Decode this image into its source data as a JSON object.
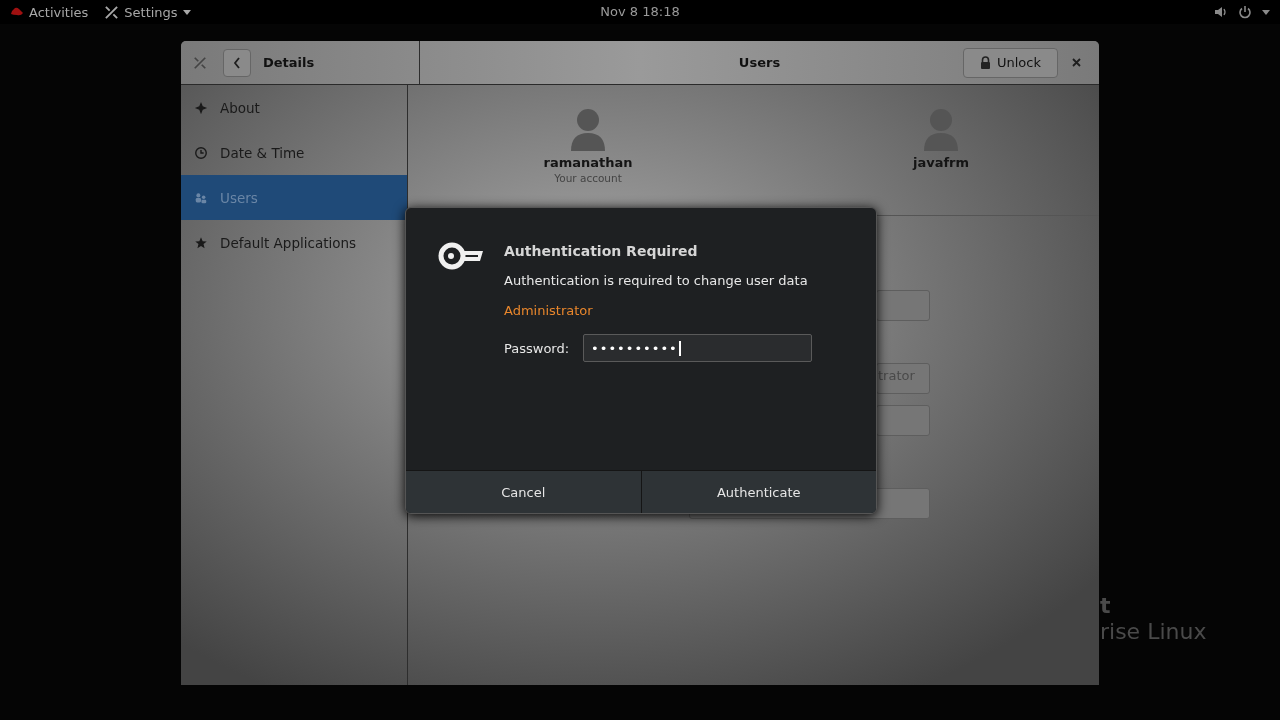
{
  "top_bar": {
    "activities": "Activities",
    "app_menu": "Settings",
    "clock": "Nov 8  18:18"
  },
  "wallpaper_text": [
    "t",
    "rise Linux"
  ],
  "window": {
    "sidebar_title": "Details",
    "title": "Users",
    "unlock_button": "Unlock",
    "sidebar": {
      "items": [
        {
          "label": "About",
          "kind": "sparkle",
          "selected": false
        },
        {
          "label": "Date & Time",
          "kind": "clock",
          "selected": false
        },
        {
          "label": "Users",
          "kind": "people",
          "selected": true
        },
        {
          "label": "Default Applications",
          "kind": "star",
          "selected": false
        }
      ]
    },
    "users": [
      {
        "name": "ramanathan",
        "subtitle": "Your account"
      },
      {
        "name": "javafrm"
      }
    ],
    "account_type_button": "trator"
  },
  "dialog": {
    "title": "Authentication Required",
    "message": "Authentication is required to change user data",
    "identity": "Administrator",
    "password_label": "Password:",
    "password_value": "••••••••••",
    "buttons": [
      "Cancel",
      "Authenticate"
    ]
  }
}
